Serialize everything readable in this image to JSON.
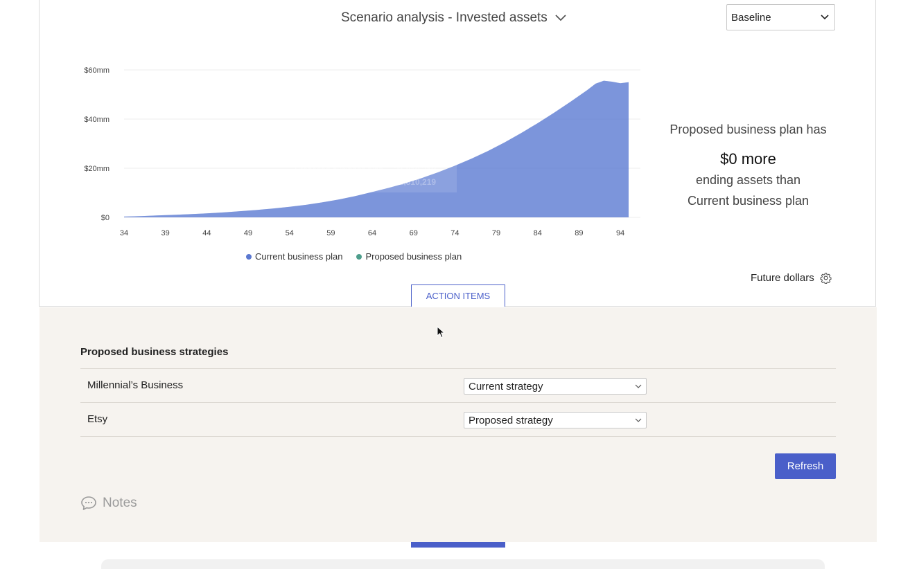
{
  "header": {
    "title": "Scenario analysis - Invested assets",
    "scenario_select": "Baseline"
  },
  "chart_data": {
    "type": "area",
    "x": [
      34,
      36,
      38,
      40,
      42,
      44,
      46,
      48,
      50,
      52,
      54,
      56,
      58,
      60,
      62,
      64,
      66,
      68,
      70,
      72,
      74,
      76,
      78,
      80,
      82,
      84,
      86,
      88,
      90,
      91,
      92,
      93,
      94,
      95
    ],
    "series": [
      {
        "name": "Current business plan",
        "values": [
          0.3,
          0.5,
          0.8,
          1.0,
          1.3,
          1.6,
          2.0,
          2.5,
          3.0,
          3.6,
          4.3,
          5.1,
          6.1,
          7.3,
          8.7,
          10.3,
          12.0,
          13.9,
          16.0,
          18.4,
          21.0,
          23.9,
          27.0,
          30.5,
          34.3,
          38.3,
          42.6,
          47.1,
          51.8,
          54.4,
          55.6,
          55.2,
          54.6,
          55.0
        ]
      },
      {
        "name": "Proposed business plan",
        "values": [
          0.3,
          0.5,
          0.8,
          1.0,
          1.3,
          1.6,
          2.0,
          2.5,
          3.0,
          3.6,
          4.3,
          5.1,
          6.1,
          7.3,
          8.7,
          10.3,
          12.0,
          13.9,
          16.0,
          18.4,
          21.0,
          23.9,
          27.0,
          30.5,
          34.3,
          38.3,
          42.6,
          47.1,
          51.8,
          54.4,
          55.6,
          55.2,
          54.6,
          55.0
        ]
      }
    ],
    "y_ticks": [
      "$0",
      "$20mm",
      "$40mm",
      "$60mm"
    ],
    "x_ticks": [
      34,
      39,
      44,
      49,
      54,
      59,
      64,
      69,
      74,
      79,
      84,
      89,
      94
    ],
    "ylim": [
      0,
      60
    ],
    "xlim": [
      34,
      95
    ],
    "tooltip": {
      "title": "75",
      "rows": [
        {
          "label": "Proposed business plan",
          "value": "21,810,219"
        },
        {
          "label": "Current business plan",
          "value": "21,810,219"
        }
      ]
    },
    "colors": {
      "current": "#5b78d0",
      "proposed": "#4e9e8c",
      "area": "#5b7ad1"
    }
  },
  "summary": {
    "line1": "Proposed business plan has",
    "line2": "$0 more",
    "line3": "ending assets than",
    "line4": "Current business plan"
  },
  "legend": {
    "current": "Current business plan",
    "proposed": "Proposed business plan"
  },
  "future_dollars": "Future dollars",
  "action_items": "ACTION ITEMS",
  "strategies": {
    "title": "Proposed business strategies",
    "rows": [
      {
        "name": "Millennial’s Business",
        "strategy": "Current strategy"
      },
      {
        "name": "Etsy",
        "strategy": "Proposed strategy"
      }
    ]
  },
  "refresh_label": "Refresh",
  "notes_label": "Notes"
}
